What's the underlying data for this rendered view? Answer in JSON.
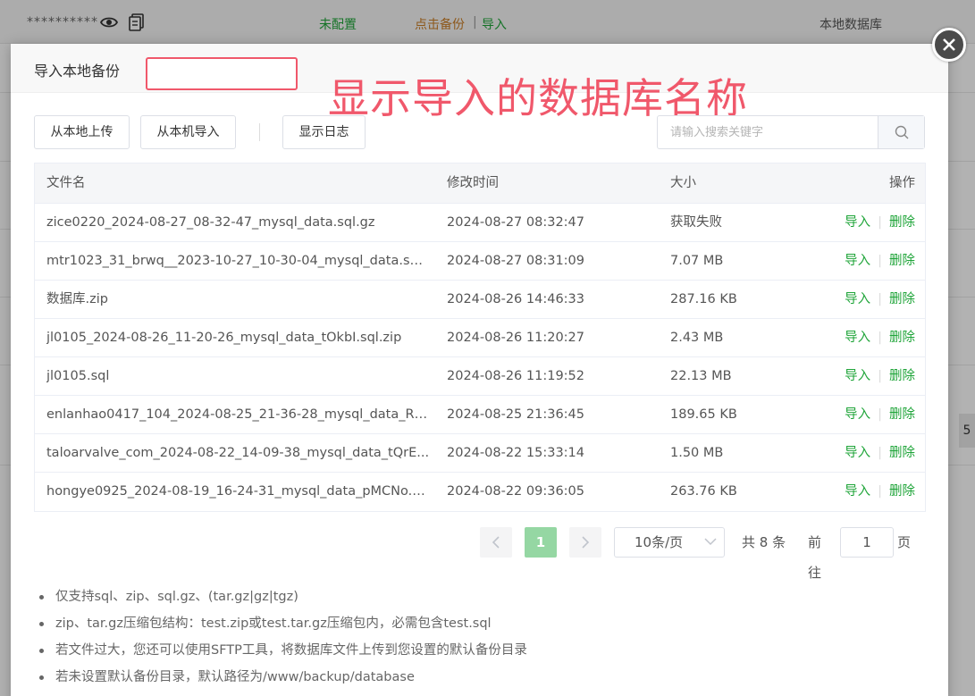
{
  "background": {
    "password_mask": "**********",
    "status_unset": "未配置",
    "backup_link": "点击备份",
    "separator": "|",
    "import_link": "导入",
    "database_location": "本地数据库",
    "side_badge": "5"
  },
  "modal": {
    "title": "导入本地备份",
    "annotation": "显示导入的数据库名称",
    "annotation_color": "#f0586b"
  },
  "toolbar": {
    "upload_label": "从本地上传",
    "local_import_label": "从本机导入",
    "show_log_label": "显示日志",
    "search_placeholder": "请输入搜索关键字"
  },
  "table": {
    "headers": {
      "name": "文件名",
      "time": "修改时间",
      "size": "大小",
      "op": "操作"
    },
    "rows": [
      {
        "name": "zice0220_2024-08-27_08-32-47_mysql_data.sql.gz",
        "time": "2024-08-27 08:32:47",
        "size": "获取失败",
        "import": "导入",
        "delete": "删除"
      },
      {
        "name": "mtr1023_31_brwq__2023-10-27_10-30-04_mysql_data.sql....",
        "time": "2024-08-27 08:31:09",
        "size": "7.07 MB",
        "import": "导入",
        "delete": "删除"
      },
      {
        "name": "数据库.zip",
        "time": "2024-08-26 14:46:33",
        "size": "287.16 KB",
        "import": "导入",
        "delete": "删除"
      },
      {
        "name": "jl0105_2024-08-26_11-20-26_mysql_data_tOkbI.sql.zip",
        "time": "2024-08-26 11:20:27",
        "size": "2.43 MB",
        "import": "导入",
        "delete": "删除"
      },
      {
        "name": "jl0105.sql",
        "time": "2024-08-26 11:19:52",
        "size": "22.13 MB",
        "import": "导入",
        "delete": "删除"
      },
      {
        "name": "enlanhao0417_104_2024-08-25_21-36-28_mysql_data_RL...",
        "time": "2024-08-25 21:36:45",
        "size": "189.65 KB",
        "import": "导入",
        "delete": "删除"
      },
      {
        "name": "taloarvalve_com_2024-08-22_14-09-38_mysql_data_tQrE...",
        "time": "2024-08-22 15:33:14",
        "size": "1.50 MB",
        "import": "导入",
        "delete": "删除"
      },
      {
        "name": "hongye0925_2024-08-19_16-24-31_mysql_data_pMCNo.s...",
        "time": "2024-08-22 09:36:05",
        "size": "263.76 KB",
        "import": "导入",
        "delete": "删除"
      }
    ]
  },
  "pagination": {
    "current_page": "1",
    "page_size": "10条/页",
    "total": "共 8 条",
    "goto_label": "前往",
    "goto_value": "1",
    "page_suffix": "页"
  },
  "tips": [
    "仅支持sql、zip、sql.gz、(tar.gz|gz|tgz)",
    "zip、tar.gz压缩包结构：test.zip或test.tar.gz压缩包内，必需包含test.sql",
    "若文件过大，您还可以使用SFTP工具，将数据库文件上传到您设置的默认备份目录",
    "若未设置默认备份目录，默认路径为/www/backup/database"
  ],
  "colors": {
    "accent_green": "#20a53a",
    "backup_orange": "#cb7f28",
    "active_page": "#95d7a3"
  }
}
